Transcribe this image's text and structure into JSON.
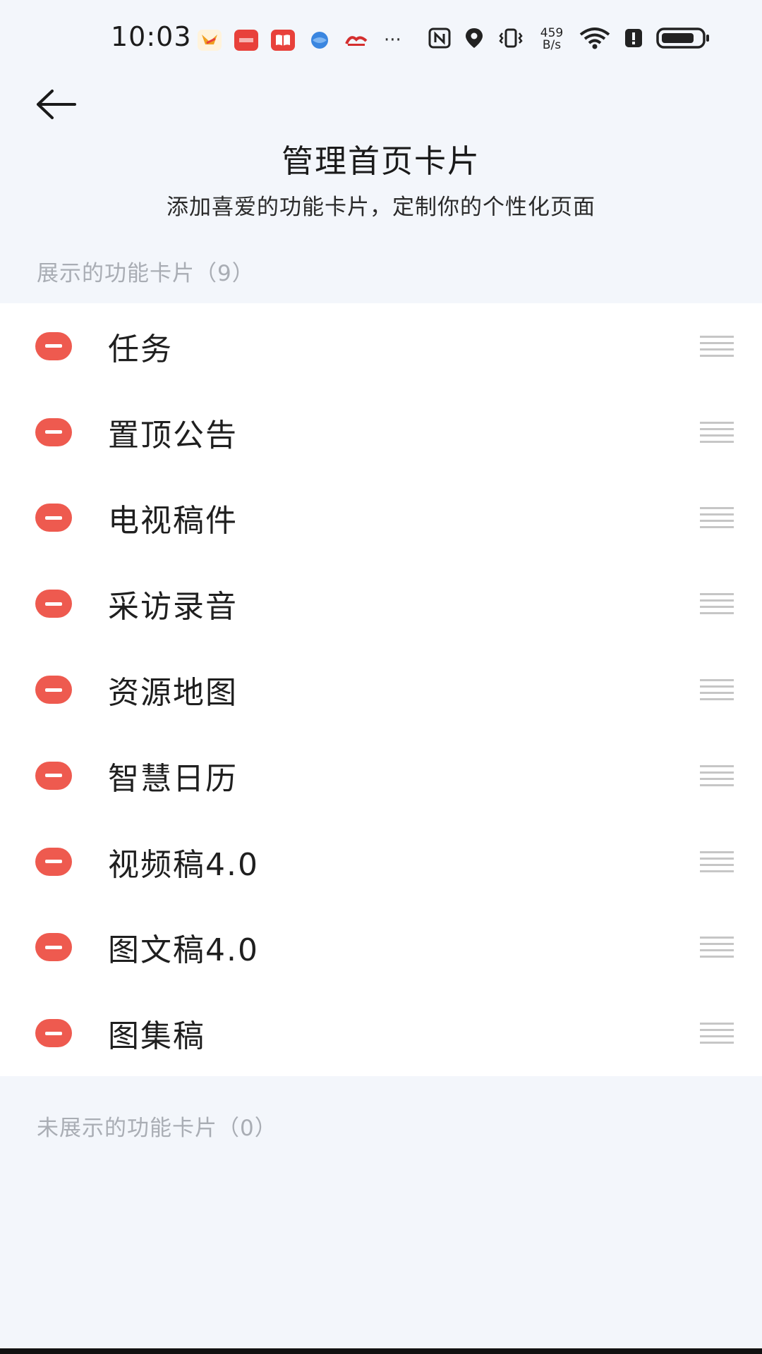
{
  "status_bar": {
    "time": "10:03",
    "net_speed_value": "459",
    "net_speed_unit": "B/s",
    "notification_icons": [
      {
        "name": "bird-app-icon",
        "color": "#f0a020"
      },
      {
        "name": "news-app-icon",
        "color": "#e8413b"
      },
      {
        "name": "book-app-icon",
        "color": "#e8413b"
      },
      {
        "name": "browser-app-icon",
        "color": "#3a86e0"
      },
      {
        "name": "logo-app-icon",
        "color": "#d42e2e"
      }
    ],
    "more_notifications": "···"
  },
  "header": {
    "title": "管理首页卡片",
    "subtitle": "添加喜爱的功能卡片，定制你的个性化页面"
  },
  "shown_section": {
    "label": "展示的功能卡片（9）",
    "items": [
      {
        "label": "任务"
      },
      {
        "label": "置顶公告"
      },
      {
        "label": "电视稿件"
      },
      {
        "label": "采访录音"
      },
      {
        "label": "资源地图"
      },
      {
        "label": "智慧日历"
      },
      {
        "label": "视频稿4.0"
      },
      {
        "label": "图文稿4.0"
      },
      {
        "label": "图集稿"
      }
    ]
  },
  "hidden_section": {
    "label": "未展示的功能卡片（0）"
  },
  "colors": {
    "background": "#f3f6fb",
    "remove_button": "#ee5a4f",
    "section_label": "#a9adb4",
    "drag_handle": "#c6c6c6"
  }
}
